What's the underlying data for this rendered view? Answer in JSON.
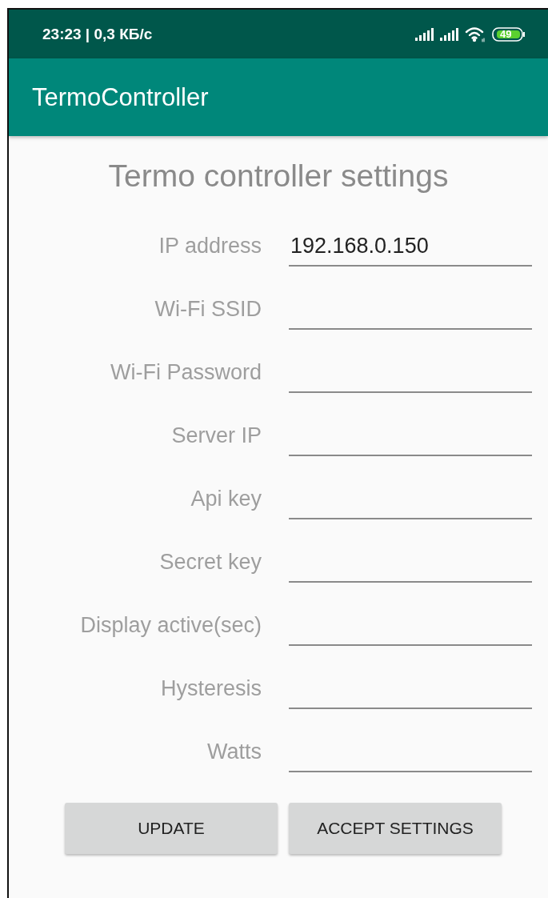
{
  "status_bar": {
    "time_speed": "23:23 | 0,3 КБ/с",
    "battery": "49"
  },
  "app_bar": {
    "title": "TermoController"
  },
  "heading": "Termo controller settings",
  "fields": [
    {
      "label": "IP address",
      "value": "192.168.0.150"
    },
    {
      "label": "Wi-Fi SSID"
    },
    {
      "label": "Wi-Fi Password"
    },
    {
      "label": "Server IP"
    },
    {
      "label": "Api key"
    },
    {
      "label": "Secret key"
    },
    {
      "label": "Display active(sec)"
    },
    {
      "label": "Hysteresis"
    },
    {
      "label": "Watts"
    }
  ],
  "buttons": [
    "UPDATE",
    "ACCEPT SETTINGS"
  ]
}
